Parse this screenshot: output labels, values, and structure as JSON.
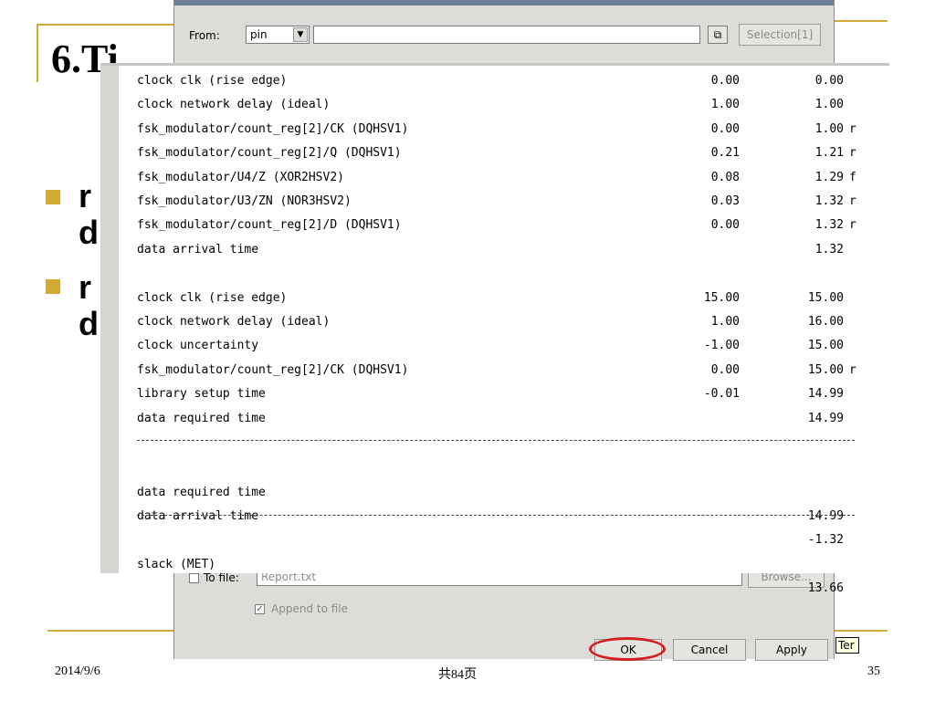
{
  "slide": {
    "title": "6.Ti",
    "bullets": [
      {
        "line1": "r",
        "line2": "d"
      },
      {
        "line1": "r",
        "line2": "d"
      }
    ],
    "footer": {
      "date": "2014/9/6",
      "page_total": "共84页",
      "page_number": "35"
    },
    "accent_color": "#d4a935"
  },
  "dialog": {
    "from_label": "From:",
    "from_value": "pin",
    "selection_button": "Selection[1]",
    "to_file_label": "To file:",
    "to_file_value": "Report.txt",
    "browse_button": "Browse...",
    "append_label": "Append to file",
    "ok_button": "OK",
    "cancel_button": "Cancel",
    "apply_button": "Apply",
    "tooltip_text": "Ter"
  },
  "report": {
    "rows": [
      {
        "name": "clock clk (rise edge)",
        "incr": "0.00",
        "path": "0.00",
        "flag": ""
      },
      {
        "name": "clock network delay (ideal)",
        "incr": "1.00",
        "path": "1.00",
        "flag": ""
      },
      {
        "name": "fsk_modulator/count_reg[2]/CK (DQHSV1)",
        "incr": "0.00",
        "path": "1.00",
        "flag": "r"
      },
      {
        "name": "fsk_modulator/count_reg[2]/Q (DQHSV1)",
        "incr": "0.21",
        "path": "1.21",
        "flag": "r"
      },
      {
        "name": "fsk_modulator/U4/Z (XOR2HSV2)",
        "incr": "0.08",
        "path": "1.29",
        "flag": "f"
      },
      {
        "name": "fsk_modulator/U3/ZN (NOR3HSV2)",
        "incr": "0.03",
        "path": "1.32",
        "flag": "r"
      },
      {
        "name": "fsk_modulator/count_reg[2]/D (DQHSV1)",
        "incr": "0.00",
        "path": "1.32",
        "flag": "r"
      },
      {
        "name": "data arrival time",
        "incr": "",
        "path": "1.32",
        "flag": ""
      },
      {
        "name": "",
        "incr": "",
        "path": "",
        "flag": ""
      },
      {
        "name": "clock clk (rise edge)",
        "incr": "15.00",
        "path": "15.00",
        "flag": ""
      },
      {
        "name": "clock network delay (ideal)",
        "incr": "1.00",
        "path": "16.00",
        "flag": ""
      },
      {
        "name": "clock uncertainty",
        "incr": "-1.00",
        "path": "15.00",
        "flag": ""
      },
      {
        "name": "fsk_modulator/count_reg[2]/CK (DQHSV1)",
        "incr": "0.00",
        "path": "15.00",
        "flag": "r"
      },
      {
        "name": "library setup time",
        "incr": "-0.01",
        "path": "14.99",
        "flag": ""
      },
      {
        "name": "data required time",
        "incr": "",
        "path": "14.99",
        "flag": ""
      }
    ],
    "summary_rows": [
      {
        "name": "data required time",
        "path": "14.99"
      },
      {
        "name": "data arrival time",
        "path": "-1.32"
      }
    ],
    "slack": {
      "name": "slack (MET)",
      "path": "13.66"
    }
  }
}
